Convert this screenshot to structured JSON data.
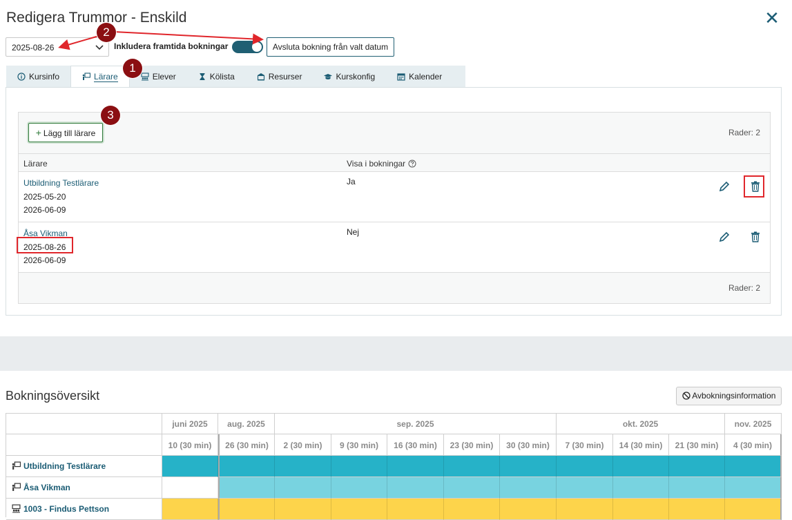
{
  "dialog": {
    "title": "Redigera Trummor - Enskild",
    "close_label": "✕"
  },
  "toolbar": {
    "date_value": "2025-08-26",
    "include_future_label": "Inkludera framtida bokningar",
    "include_future_on": true,
    "end_booking_label": "Avsluta bokning från valt datum"
  },
  "tabs": [
    {
      "label": "Kursinfo",
      "icon": "info-icon",
      "active": false
    },
    {
      "label": "Lärare",
      "icon": "teacher-icon",
      "active": true
    },
    {
      "label": "Elever",
      "icon": "students-icon",
      "active": false
    },
    {
      "label": "Kölista",
      "icon": "hourglass-icon",
      "active": false
    },
    {
      "label": "Resurser",
      "icon": "building-icon",
      "active": false
    },
    {
      "label": "Kurskonfig",
      "icon": "graduation-cap-icon",
      "active": false
    },
    {
      "label": "Kalender",
      "icon": "calendar-icon",
      "active": false
    }
  ],
  "teachers_panel": {
    "add_button_label": "Lägg till lärare",
    "rows_count_label": "Rader: 2",
    "columns": {
      "teacher": "Lärare",
      "show_in_bookings": "Visa i bokningar"
    },
    "rows": [
      {
        "name": "Utbildning Testlärare",
        "start": "2025-05-20",
        "end": "2026-06-09",
        "show": "Ja"
      },
      {
        "name": "Åsa Vikman",
        "start": "2025-08-26",
        "end": "2026-06-09",
        "show": "Nej"
      }
    ]
  },
  "annotations": {
    "badge_1": "1",
    "badge_2": "2",
    "badge_3": "3",
    "color": "#e0262b"
  },
  "overview": {
    "title": "Bokningsöversikt",
    "cancel_info_label": "Avbokningsinformation",
    "months": [
      "juni 2025",
      "aug. 2025",
      "sep. 2025",
      "okt. 2025",
      "nov. 2025"
    ],
    "dates": [
      "10 (30 min)",
      "26 (30 min)",
      "2 (30 min)",
      "9 (30 min)",
      "16 (30 min)",
      "23 (30 min)",
      "30 (30 min)",
      "7 (30 min)",
      "14 (30 min)",
      "21 (30 min)",
      "4 (30 min)"
    ],
    "rows": [
      {
        "label": "Utbildning Testlärare",
        "icon": "teacher-icon",
        "color": "#26b2c8",
        "from_index": 0
      },
      {
        "label": "Åsa Vikman",
        "icon": "teacher-icon",
        "color": "#78d3e0",
        "from_index": 1
      },
      {
        "label": "1003 - Findus Pettson",
        "icon": "students-icon",
        "color": "#fdd44b",
        "from_index": 0
      }
    ]
  }
}
